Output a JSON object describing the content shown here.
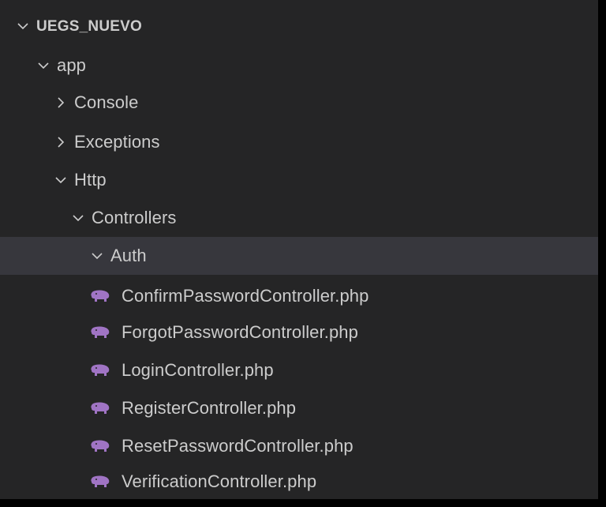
{
  "explorer": {
    "root": {
      "label": "UEGS_NUEVO",
      "expanded": true
    },
    "tree": [
      {
        "label": "app",
        "kind": "folder",
        "expanded": true
      },
      {
        "label": "Console",
        "kind": "folder",
        "expanded": false
      },
      {
        "label": "Exceptions",
        "kind": "folder",
        "expanded": false
      },
      {
        "label": "Http",
        "kind": "folder",
        "expanded": true
      },
      {
        "label": "Controllers",
        "kind": "folder",
        "expanded": true
      },
      {
        "label": "Auth",
        "kind": "folder",
        "expanded": true,
        "selected": true
      },
      {
        "label": "ConfirmPasswordController.php",
        "kind": "file",
        "icon": "php-elephant-icon"
      },
      {
        "label": "ForgotPasswordController.php",
        "kind": "file",
        "icon": "php-elephant-icon"
      },
      {
        "label": "LoginController.php",
        "kind": "file",
        "icon": "php-elephant-icon"
      },
      {
        "label": "RegisterController.php",
        "kind": "file",
        "icon": "php-elephant-icon"
      },
      {
        "label": "ResetPasswordController.php",
        "kind": "file",
        "icon": "php-elephant-icon"
      },
      {
        "label": "VerificationController.php",
        "kind": "file",
        "icon": "php-elephant-icon"
      }
    ]
  },
  "colors": {
    "background": "#252526",
    "selected_row": "#37373d",
    "text": "#cccccc",
    "php_icon": "#a074c4",
    "edge": "#000000"
  }
}
